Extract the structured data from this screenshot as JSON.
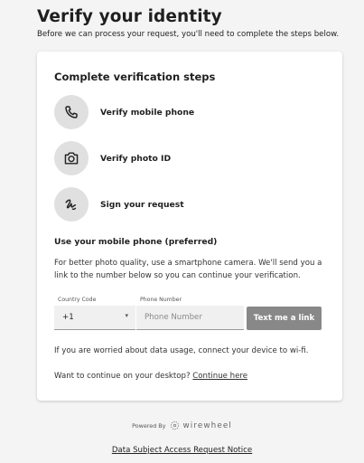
{
  "header": {
    "title": "Verify your identity",
    "subtitle": "Before we can process your request, you'll need to complete the steps below."
  },
  "card": {
    "title": "Complete verification steps",
    "steps": [
      {
        "label": "Verify mobile phone",
        "icon": "phone-icon"
      },
      {
        "label": "Verify photo ID",
        "icon": "camera-icon"
      },
      {
        "label": "Sign your request",
        "icon": "signature-icon"
      }
    ],
    "mobile": {
      "title": "Use your mobile phone (preferred)",
      "description": "For better photo quality, use a smartphone camera. We'll send you a link to the number below so you can continue your verification.",
      "country_label": "Country Code",
      "country_value": "+1",
      "phone_label": "Phone Number",
      "phone_placeholder": "Phone Number",
      "button_label": "Text me a link"
    },
    "wifi_note": "If you are worried about data usage, connect your device to wi-fi.",
    "desktop_prompt": "Want to continue on your desktop?",
    "desktop_link": "Continue here"
  },
  "footer": {
    "powered_by": "Powered By",
    "brand": "wirewheel",
    "notice_link": "Data Subject Access Request Notice"
  },
  "colors": {
    "background": "#f4f4f4",
    "card": "#ffffff",
    "icon_circle": "#e0e0e0",
    "button": "#888888"
  }
}
